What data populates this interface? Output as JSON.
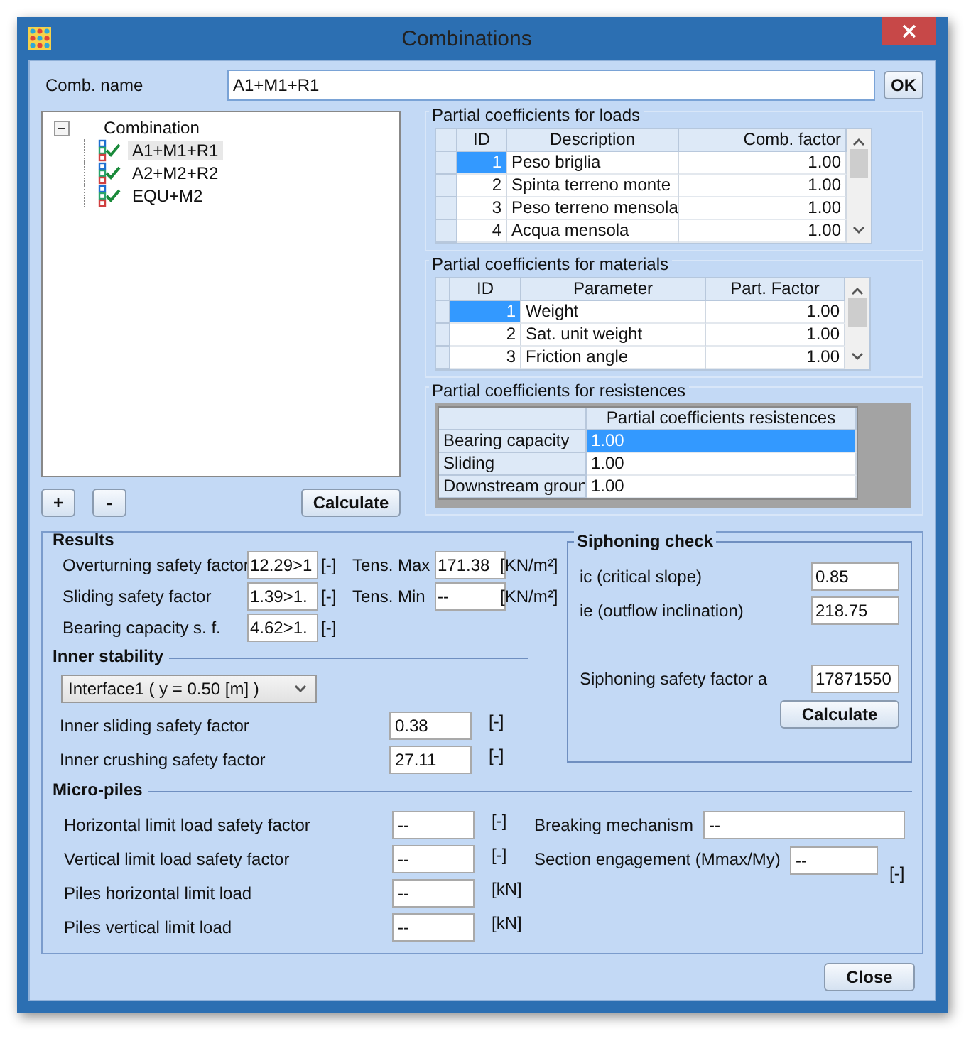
{
  "window": {
    "title": "Combinations"
  },
  "comb_name": {
    "label": "Comb. name",
    "value": "A1+M1+R1",
    "ok": "OK"
  },
  "tree": {
    "label": "Combination",
    "expanded": true,
    "children": [
      {
        "label": "A1+M1+R1",
        "selected": true
      },
      {
        "label": "A2+M2+R2",
        "selected": false
      },
      {
        "label": "EQU+M2",
        "selected": false
      }
    ]
  },
  "tree_buttons": {
    "add": "+",
    "remove": "-",
    "calculate": "Calculate"
  },
  "loads": {
    "title": "Partial coefficients for loads",
    "columns": [
      "ID",
      "Description",
      "Comb. factor"
    ],
    "rows": [
      {
        "id": "1",
        "name": "Peso briglia",
        "value": "1.00",
        "selected": true
      },
      {
        "id": "2",
        "name": "Spinta terreno monte",
        "value": "1.00",
        "selected": false
      },
      {
        "id": "3",
        "name": "Peso terreno mensola",
        "value": "1.00",
        "selected": false
      },
      {
        "id": "4",
        "name": "Acqua mensola",
        "value": "1.00",
        "selected": false
      }
    ]
  },
  "materials": {
    "title": "Partial coefficients for materials",
    "columns": [
      "ID",
      "Parameter",
      "Part. Factor"
    ],
    "rows": [
      {
        "id": "1",
        "name": "Weight",
        "value": "1.00",
        "selected": true
      },
      {
        "id": "2",
        "name": "Sat. unit weight",
        "value": "1.00",
        "selected": false
      },
      {
        "id": "3",
        "name": "Friction angle",
        "value": "1.00",
        "selected": false
      }
    ]
  },
  "resistances": {
    "title": "Partial coefficients for resistences",
    "column": "Partial coefficients resistences",
    "rows": [
      {
        "name": "Bearing capacity",
        "value": "1.00",
        "selected": true
      },
      {
        "name": "Sliding",
        "value": "1.00",
        "selected": false
      },
      {
        "name": "Downstream groun",
        "value": "1.00",
        "selected": false
      }
    ]
  },
  "results": {
    "title": "Results",
    "rows": [
      {
        "label": "Overturning safety factor",
        "value": "12.29>1",
        "unit": "[-]",
        "tens_label": "Tens. Max",
        "tens_value": "171.38",
        "tens_unit": "[KN/m²]"
      },
      {
        "label": "Sliding safety factor",
        "value": "1.39>1.",
        "unit": "[-]",
        "tens_label": "Tens. Min",
        "tens_value": "--",
        "tens_unit": "[KN/m²]"
      },
      {
        "label": "Bearing capacity s. f.",
        "value": "4.62>1.",
        "unit": "[-]"
      }
    ]
  },
  "inner_stability": {
    "title": "Inner stability",
    "dropdown": "Interface1 ( y = 0.50 [m] )",
    "rows": [
      {
        "label": "Inner sliding safety factor",
        "value": "0.38",
        "unit": "[-]"
      },
      {
        "label": "Inner crushing safety factor",
        "value": "27.11",
        "unit": "[-]"
      }
    ]
  },
  "siphoning": {
    "title": "Siphoning check",
    "rows": [
      {
        "label": "ic (critical slope)",
        "value": "0.85"
      },
      {
        "label": "ie (outflow inclination)",
        "value": "218.75"
      },
      {
        "label": "Siphoning safety factor a",
        "value": "17871550"
      }
    ],
    "calculate": "Calculate"
  },
  "micro_piles": {
    "title": "Micro-piles",
    "rows": [
      {
        "label": "Horizontal limit load safety factor",
        "value": "--",
        "unit": "[-]"
      },
      {
        "label": "Vertical limit load safety factor",
        "value": "--",
        "unit": "[-]"
      },
      {
        "label": "Piles horizontal limit load",
        "value": "--",
        "unit": "[kN]"
      },
      {
        "label": "Piles vertical limit load",
        "value": "--",
        "unit": "[kN]"
      }
    ],
    "breaking": {
      "label": "Breaking mechanism",
      "value": "--"
    },
    "section": {
      "label": "Section engagement (Mmax/My)",
      "value": "--",
      "unit": "[-]"
    }
  },
  "close_button": "Close"
}
